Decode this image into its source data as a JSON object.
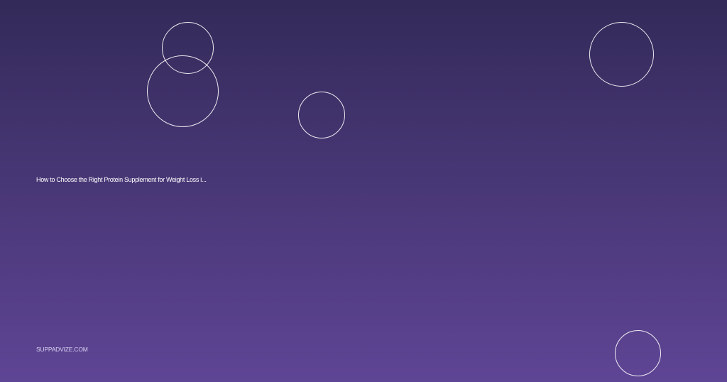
{
  "card": {
    "headline": "How to Choose the Right Protein Supplement for Weight Loss i...",
    "site": "SUPPADVIZE.COM"
  },
  "colors": {
    "gradient_top": "#332a59",
    "gradient_bottom": "#5f4595",
    "ring": "#ffffff",
    "headline_text": "#ffffff",
    "site_text": "#d9d3f2"
  },
  "decoration": {
    "shape": "circle-outline",
    "count": 5
  }
}
